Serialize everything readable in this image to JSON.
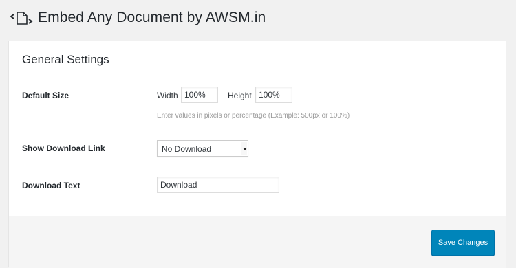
{
  "header": {
    "title": "Embed Any Document by AWSM.in",
    "icon": "document-embed-icon"
  },
  "settings": {
    "section_title": "General Settings",
    "default_size": {
      "label": "Default Size",
      "width_label": "Width",
      "width_value": "100%",
      "height_label": "Height",
      "height_value": "100%",
      "hint": "Enter values in pixels or percentage (Example: 500px or 100%)"
    },
    "show_download_link": {
      "label": "Show Download Link",
      "selected": "No Download"
    },
    "download_text": {
      "label": "Download Text",
      "value": "Download"
    }
  },
  "footer": {
    "save_label": "Save Changes",
    "save_color": "#0085ba"
  }
}
